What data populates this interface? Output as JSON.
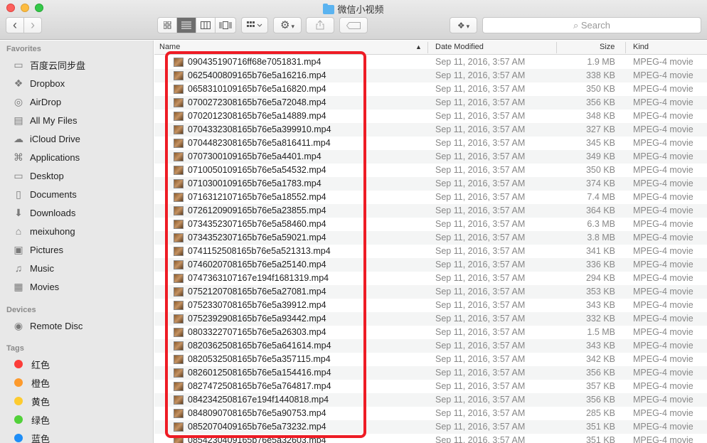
{
  "window": {
    "title": "微信小视频"
  },
  "toolbar": {
    "back_icon": "‹",
    "forward_icon": "›",
    "search_placeholder": "Search",
    "search_icon": "⌕"
  },
  "sidebar": {
    "favorites_header": "Favorites",
    "favorites": [
      {
        "label": "百度云同步盘",
        "icon": "folder-icon"
      },
      {
        "label": "Dropbox",
        "icon": "dropbox-icon"
      },
      {
        "label": "AirDrop",
        "icon": "airdrop-icon"
      },
      {
        "label": "All My Files",
        "icon": "all-files-icon"
      },
      {
        "label": "iCloud Drive",
        "icon": "cloud-icon"
      },
      {
        "label": "Applications",
        "icon": "applications-icon"
      },
      {
        "label": "Desktop",
        "icon": "desktop-icon"
      },
      {
        "label": "Documents",
        "icon": "documents-icon"
      },
      {
        "label": "Downloads",
        "icon": "downloads-icon"
      },
      {
        "label": "meixuhong",
        "icon": "home-icon"
      },
      {
        "label": "Pictures",
        "icon": "pictures-icon"
      },
      {
        "label": "Music",
        "icon": "music-icon"
      },
      {
        "label": "Movies",
        "icon": "movies-icon"
      }
    ],
    "devices_header": "Devices",
    "devices": [
      {
        "label": "Remote Disc",
        "icon": "disc-icon"
      }
    ],
    "tags_header": "Tags",
    "tags": [
      {
        "label": "红色",
        "color": "#fc3d39"
      },
      {
        "label": "橙色",
        "color": "#fd9a2c"
      },
      {
        "label": "黄色",
        "color": "#fdcb2f"
      },
      {
        "label": "绿色",
        "color": "#52d13a"
      },
      {
        "label": "蓝色",
        "color": "#1f8ef7"
      }
    ]
  },
  "columns": {
    "name": "Name",
    "date": "Date Modified",
    "size": "Size",
    "kind": "Kind"
  },
  "files": [
    {
      "name": "090435190716ff68e7051831.mp4",
      "date": "Sep 11, 2016, 3:57 AM",
      "size": "1.9 MB",
      "kind": "MPEG-4 movie"
    },
    {
      "name": "0625400809165b76e5a16216.mp4",
      "date": "Sep 11, 2016, 3:57 AM",
      "size": "338 KB",
      "kind": "MPEG-4 movie"
    },
    {
      "name": "0658310109165b76e5a16820.mp4",
      "date": "Sep 11, 2016, 3:57 AM",
      "size": "350 KB",
      "kind": "MPEG-4 movie"
    },
    {
      "name": "0700272308165b76e5a72048.mp4",
      "date": "Sep 11, 2016, 3:57 AM",
      "size": "356 KB",
      "kind": "MPEG-4 movie"
    },
    {
      "name": "0702012308165b76e5a14889.mp4",
      "date": "Sep 11, 2016, 3:57 AM",
      "size": "348 KB",
      "kind": "MPEG-4 movie"
    },
    {
      "name": "0704332308165b76e5a399910.mp4",
      "date": "Sep 11, 2016, 3:57 AM",
      "size": "327 KB",
      "kind": "MPEG-4 movie"
    },
    {
      "name": "0704482308165b76e5a816411.mp4",
      "date": "Sep 11, 2016, 3:57 AM",
      "size": "345 KB",
      "kind": "MPEG-4 movie"
    },
    {
      "name": "0707300109165b76e5a4401.mp4",
      "date": "Sep 11, 2016, 3:57 AM",
      "size": "349 KB",
      "kind": "MPEG-4 movie"
    },
    {
      "name": "0710050109165b76e5a54532.mp4",
      "date": "Sep 11, 2016, 3:57 AM",
      "size": "350 KB",
      "kind": "MPEG-4 movie"
    },
    {
      "name": "0710300109165b76e5a1783.mp4",
      "date": "Sep 11, 2016, 3:57 AM",
      "size": "374 KB",
      "kind": "MPEG-4 movie"
    },
    {
      "name": "0716312107165b76e5a18552.mp4",
      "date": "Sep 11, 2016, 3:57 AM",
      "size": "7.4 MB",
      "kind": "MPEG-4 movie"
    },
    {
      "name": "0726120909165b76e5a23855.mp4",
      "date": "Sep 11, 2016, 3:57 AM",
      "size": "364 KB",
      "kind": "MPEG-4 movie"
    },
    {
      "name": "0734352307165b76e5a58460.mp4",
      "date": "Sep 11, 2016, 3:57 AM",
      "size": "6.3 MB",
      "kind": "MPEG-4 movie"
    },
    {
      "name": "0734352307165b76e5a59021.mp4",
      "date": "Sep 11, 2016, 3:57 AM",
      "size": "3.8 MB",
      "kind": "MPEG-4 movie"
    },
    {
      "name": "0741152508165b76e5a521313.mp4",
      "date": "Sep 11, 2016, 3:57 AM",
      "size": "341 KB",
      "kind": "MPEG-4 movie"
    },
    {
      "name": "0746020708165b76e5a25140.mp4",
      "date": "Sep 11, 2016, 3:57 AM",
      "size": "336 KB",
      "kind": "MPEG-4 movie"
    },
    {
      "name": "0747363107167e194f1681319.mp4",
      "date": "Sep 11, 2016, 3:57 AM",
      "size": "294 KB",
      "kind": "MPEG-4 movie"
    },
    {
      "name": "0752120708165b76e5a27081.mp4",
      "date": "Sep 11, 2016, 3:57 AM",
      "size": "353 KB",
      "kind": "MPEG-4 movie"
    },
    {
      "name": "0752330708165b76e5a39912.mp4",
      "date": "Sep 11, 2016, 3:57 AM",
      "size": "343 KB",
      "kind": "MPEG-4 movie"
    },
    {
      "name": "0752392908165b76e5a93442.mp4",
      "date": "Sep 11, 2016, 3:57 AM",
      "size": "332 KB",
      "kind": "MPEG-4 movie"
    },
    {
      "name": "0803322707165b76e5a26303.mp4",
      "date": "Sep 11, 2016, 3:57 AM",
      "size": "1.5 MB",
      "kind": "MPEG-4 movie"
    },
    {
      "name": "0820362508165b76e5a641614.mp4",
      "date": "Sep 11, 2016, 3:57 AM",
      "size": "343 KB",
      "kind": "MPEG-4 movie"
    },
    {
      "name": "0820532508165b76e5a357115.mp4",
      "date": "Sep 11, 2016, 3:57 AM",
      "size": "342 KB",
      "kind": "MPEG-4 movie"
    },
    {
      "name": "0826012508165b76e5a154416.mp4",
      "date": "Sep 11, 2016, 3:57 AM",
      "size": "356 KB",
      "kind": "MPEG-4 movie"
    },
    {
      "name": "0827472508165b76e5a764817.mp4",
      "date": "Sep 11, 2016, 3:57 AM",
      "size": "357 KB",
      "kind": "MPEG-4 movie"
    },
    {
      "name": "0842342508167e194f1440818.mp4",
      "date": "Sep 11, 2016, 3:57 AM",
      "size": "356 KB",
      "kind": "MPEG-4 movie"
    },
    {
      "name": "0848090708165b76e5a90753.mp4",
      "date": "Sep 11, 2016, 3:57 AM",
      "size": "285 KB",
      "kind": "MPEG-4 movie"
    },
    {
      "name": "0852070409165b76e5a73232.mp4",
      "date": "Sep 11, 2016, 3:57 AM",
      "size": "351 KB",
      "kind": "MPEG-4 movie"
    },
    {
      "name": "0854230409165b76e5a32603.mp4",
      "date": "Sep 11, 2016, 3:57 AM",
      "size": "351 KB",
      "kind": "MPEG-4 movie"
    }
  ],
  "colors": {
    "highlight": "#ee1c25",
    "selected_view": "#6e6e6e"
  }
}
